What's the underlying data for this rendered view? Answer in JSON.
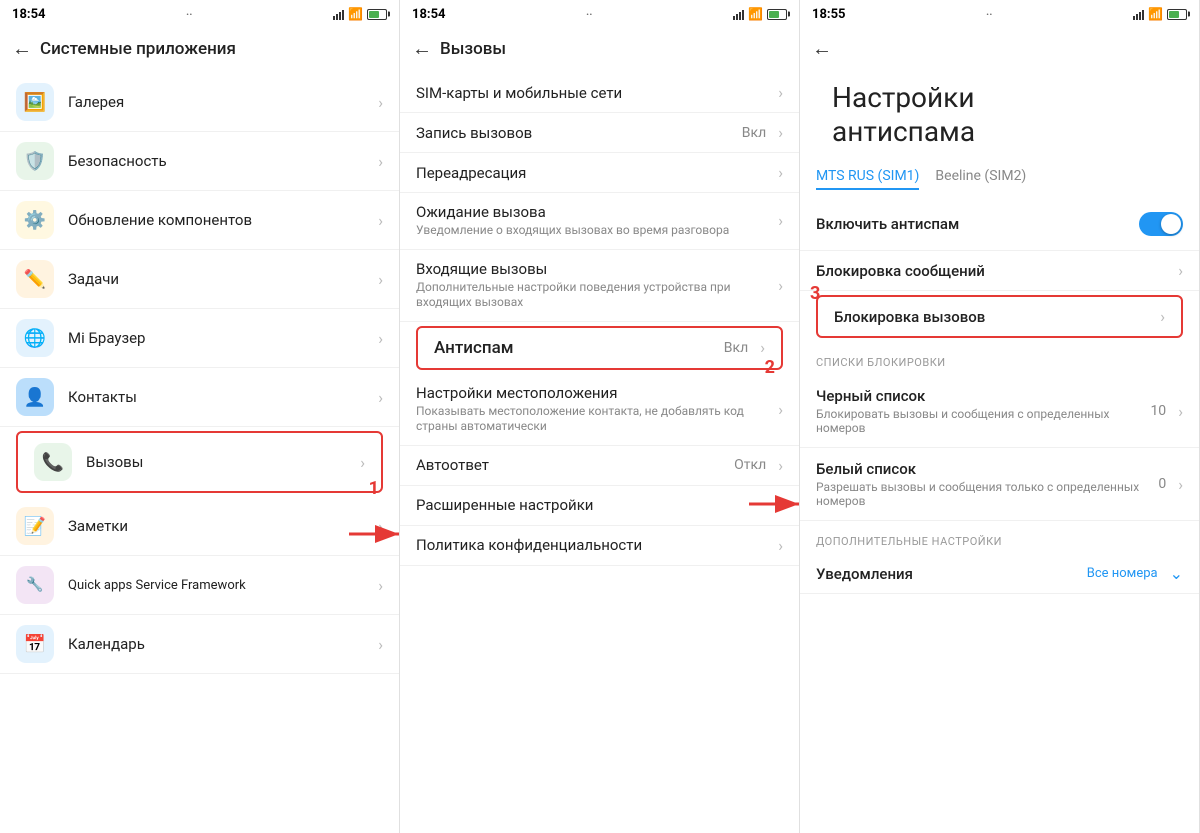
{
  "panel1": {
    "statusBar": {
      "time": "18:54",
      "dots": "··",
      "batteryLevel": "48"
    },
    "header": {
      "backLabel": "←",
      "title": "Системные приложения"
    },
    "items": [
      {
        "id": "gallery",
        "icon": "🖼️",
        "iconBg": "#e3f2fd",
        "label": "Галерея",
        "sublabel": ""
      },
      {
        "id": "security",
        "icon": "🛡️",
        "iconBg": "#e8f5e9",
        "label": "Безопасность",
        "sublabel": ""
      },
      {
        "id": "updates",
        "icon": "⚙️",
        "iconBg": "#fff8e1",
        "label": "Обновление компонентов",
        "sublabel": ""
      },
      {
        "id": "tasks",
        "icon": "✏️",
        "iconBg": "#fff3e0",
        "label": "Задачи",
        "sublabel": ""
      },
      {
        "id": "browser",
        "icon": "🌐",
        "iconBg": "#e3f2fd",
        "label": "Mi Браузер",
        "sublabel": ""
      },
      {
        "id": "contacts",
        "icon": "👤",
        "iconBg": "#e3f2fd",
        "label": "Контакты",
        "sublabel": ""
      },
      {
        "id": "calls",
        "icon": "📞",
        "iconBg": "#e8f5e9",
        "label": "Вызовы",
        "sublabel": "",
        "highlighted": true
      },
      {
        "id": "notes",
        "icon": "📝",
        "iconBg": "#fff3e0",
        "label": "Заметки",
        "sublabel": ""
      },
      {
        "id": "quickapps",
        "icon": "🔧",
        "iconBg": "#f3e5f5",
        "label": "Quick apps Service Framework",
        "sublabel": ""
      },
      {
        "id": "calendar",
        "icon": "📅",
        "iconBg": "#e3f2fd",
        "label": "Календарь",
        "sublabel": ""
      }
    ],
    "annotation": "1"
  },
  "panel2": {
    "statusBar": {
      "time": "18:54",
      "dots": "··"
    },
    "header": {
      "backLabel": "←",
      "title": "Вызовы"
    },
    "items": [
      {
        "id": "sim",
        "label": "SIM-карты и мобильные сети",
        "sublabel": "",
        "value": ""
      },
      {
        "id": "record",
        "label": "Запись вызовов",
        "sublabel": "",
        "value": "Вкл"
      },
      {
        "id": "forward",
        "label": "Переадресация",
        "sublabel": "",
        "value": ""
      },
      {
        "id": "waiting",
        "label": "Ожидание вызова",
        "sublabel": "Уведомление о входящих вызовах во время разговора",
        "value": ""
      },
      {
        "id": "incoming",
        "label": "Входящие вызовы",
        "sublabel": "Дополнительные настройки поведения устройства при входящих вызовах",
        "value": ""
      },
      {
        "id": "antispam",
        "label": "Антиспам",
        "sublabel": "",
        "value": "Вкл",
        "highlighted": true
      },
      {
        "id": "location",
        "label": "Настройки местоположения",
        "sublabel": "Показывать местоположение контакта, не добавлять код страны автоматически",
        "value": ""
      },
      {
        "id": "autoreply",
        "label": "Автоответ",
        "sublabel": "",
        "value": "Откл"
      },
      {
        "id": "advanced",
        "label": "Расширенные настройки",
        "sublabel": "",
        "value": ""
      },
      {
        "id": "privacy",
        "label": "Политика конфиденциальности",
        "sublabel": "",
        "value": ""
      }
    ],
    "annotation": "2"
  },
  "panel3": {
    "statusBar": {
      "time": "18:55",
      "dots": "··"
    },
    "header": {
      "backLabel": "←"
    },
    "title": "Настройки\nантиспама",
    "simTabs": [
      {
        "id": "sim1",
        "label": "MTS RUS (SIM1)",
        "active": true
      },
      {
        "id": "sim2",
        "label": "Beeline (SIM2)",
        "active": false
      }
    ],
    "toggleRow": {
      "label": "Включить антиспам",
      "enabled": true
    },
    "blockMessages": {
      "label": "Блокировка сообщений"
    },
    "blockCalls": {
      "label": "Блокировка вызовов",
      "highlighted": true
    },
    "sections": {
      "blockLists": "СПИСКИ БЛОКИРОВКИ",
      "additionalSettings": "ДОПОЛНИТЕЛЬНЫЕ НАСТРОЙКИ"
    },
    "blackList": {
      "label": "Черный список",
      "sublabel": "Блокировать вызовы и сообщения с определенных номеров",
      "count": "10"
    },
    "whiteList": {
      "label": "Белый список",
      "sublabel": "Разрешать вызовы и сообщения только с определенных номеров",
      "count": "0"
    },
    "notifications": {
      "label": "Уведомления",
      "value": "Все номера"
    },
    "annotation": "3"
  }
}
